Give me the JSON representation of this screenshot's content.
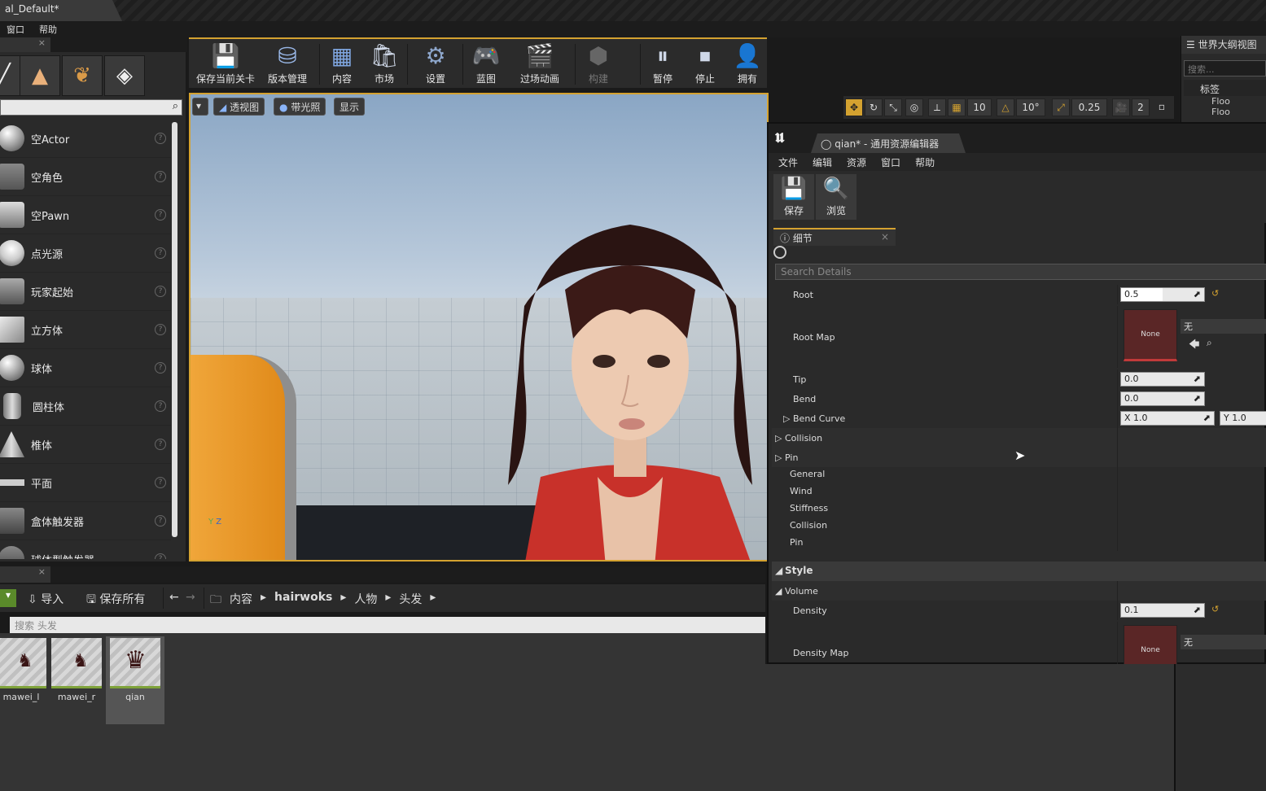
{
  "window": {
    "title": "al_Default*"
  },
  "menubar": {
    "items": [
      "窗口",
      "帮助"
    ]
  },
  "modes": {
    "tab_close": "×",
    "items": [
      {
        "label": "空Actor"
      },
      {
        "label": "空角色"
      },
      {
        "label": "空Pawn"
      },
      {
        "label": "点光源"
      },
      {
        "label": "玩家起始"
      },
      {
        "label": "立方体"
      },
      {
        "label": "球体"
      },
      {
        "label": "圆柱体"
      },
      {
        "label": "椎体"
      },
      {
        "label": "平面"
      },
      {
        "label": "盒体触发器"
      },
      {
        "label": "球体型触发器"
      }
    ],
    "help_glyph": "?"
  },
  "toolbar": {
    "buttons": [
      {
        "label": "保存当前关卡",
        "icon": "save-icon",
        "disabled": false
      },
      {
        "label": "版本管理",
        "icon": "source-control-icon",
        "disabled": false
      },
      {
        "label": "内容",
        "icon": "content-icon",
        "disabled": false
      },
      {
        "label": "市场",
        "icon": "marketplace-icon",
        "disabled": false
      },
      {
        "label": "设置",
        "icon": "settings-icon",
        "disabled": false
      },
      {
        "label": "蓝图",
        "icon": "blueprint-icon",
        "disabled": false
      },
      {
        "label": "过场动画",
        "icon": "cinematics-icon",
        "disabled": false
      },
      {
        "label": "构建",
        "icon": "build-icon",
        "disabled": true
      },
      {
        "label": "暂停",
        "icon": "pause-icon",
        "disabled": false
      },
      {
        "label": "停止",
        "icon": "stop-icon",
        "disabled": false
      },
      {
        "label": "拥有",
        "icon": "possess-icon",
        "disabled": false
      }
    ]
  },
  "viewport": {
    "perspective_label": "透视图",
    "lit_label": "带光照",
    "show_label": "显示",
    "grid_snap": "10",
    "rot_snap": "10°",
    "scale_snap": "0.25",
    "cam_speed": "2"
  },
  "outliner": {
    "title": "世界大纲视图",
    "search_placeholder": "搜索...",
    "column": "标签",
    "rows": [
      "Floo",
      "Floo"
    ]
  },
  "content_browser": {
    "tab_close": "×",
    "import_label": "导入",
    "save_all_label": "保存所有",
    "path": [
      "内容",
      "hairwoks",
      "人物",
      "头发"
    ],
    "search_placeholder": "搜索 头发",
    "assets": [
      {
        "name": "mawei_l"
      },
      {
        "name": "mawei_r"
      },
      {
        "name": "qian"
      }
    ]
  },
  "asset_editor": {
    "tab_title": "qian* - 通用资源编辑器",
    "menu": [
      "文件",
      "编辑",
      "资源",
      "窗口",
      "帮助"
    ],
    "tools": [
      {
        "label": "保存",
        "icon": "save-icon"
      },
      {
        "label": "浏览",
        "icon": "browse-icon"
      }
    ],
    "details_tab": "细节",
    "search_placeholder": "Search Details",
    "properties": {
      "root_label": "Root",
      "root_value": "0.5",
      "root_fraction": 0.5,
      "root_map_label": "Root Map",
      "root_map_thumb": "None",
      "root_map_value": "无",
      "tip_label": "Tip",
      "tip_value": "0.0",
      "bend_label": "Bend",
      "bend_value": "0.0",
      "bend_curve_label": "Bend Curve",
      "bend_curve_x": "X  1.0",
      "bend_curve_y": "Y  1.0",
      "collision_label": "Collision",
      "pin_label": "Pin",
      "sub_general": "General",
      "sub_wind": "Wind",
      "sub_stiffness": "Stiffness",
      "sub_collision": "Collision",
      "sub_pin": "Pin",
      "style_label": "Style",
      "volume_label": "Volume",
      "density_label": "Density",
      "density_value": "0.1",
      "density_map_label": "Density Map",
      "density_map_thumb": "None",
      "density_map_value": "无"
    }
  },
  "colors": {
    "accent": "#d4a230",
    "background": "#2a2a2a"
  }
}
